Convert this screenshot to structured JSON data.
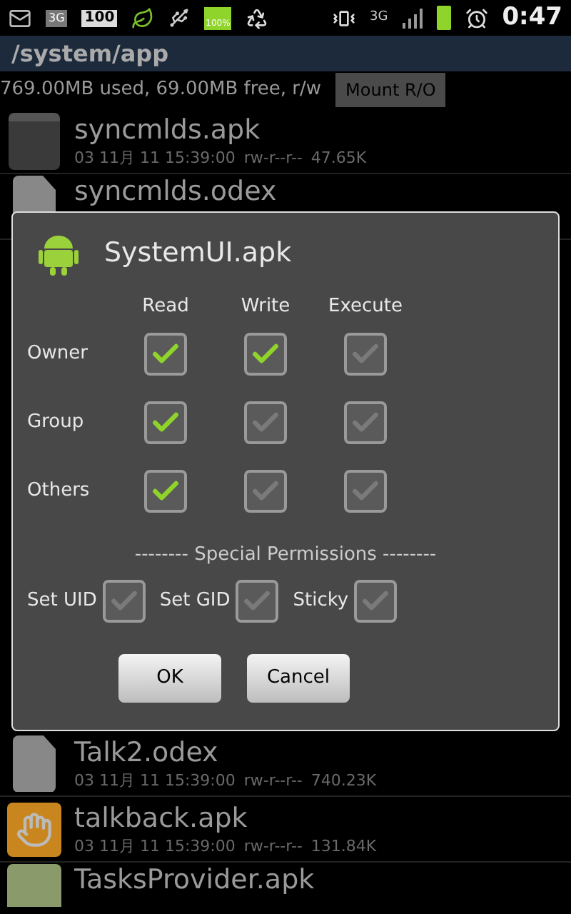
{
  "status_bar": {
    "left_badges": [
      "3G",
      "100"
    ],
    "network": "3G",
    "battery_label": "100%",
    "time": "0:47"
  },
  "path": "/system/app",
  "storage": {
    "info": "769.00MB used, 69.00MB free, r/w",
    "button": "Mount R/O"
  },
  "files_above": [
    {
      "name": "syncmlds.apk",
      "kind": "package",
      "date": "03 11月 11 15:39:00",
      "perms": "rw-r--r--",
      "size": "47.65K"
    },
    {
      "name": "syncmlds.odex",
      "kind": "odex"
    }
  ],
  "files_below": [
    {
      "name": "Talk2.odex",
      "kind": "odex",
      "date": "03 11月 11 15:39:00",
      "perms": "rw-r--r--",
      "size": "740.23K"
    },
    {
      "name": "talkback.apk",
      "kind": "hand",
      "date": "03 11月 11 15:39:00",
      "perms": "rw-r--r--",
      "size": "131.84K"
    },
    {
      "name": "TasksProvider.apk",
      "kind": "tasks"
    }
  ],
  "dialog": {
    "title": "SystemUI.apk",
    "columns": [
      "Read",
      "Write",
      "Execute"
    ],
    "rows": [
      {
        "label": "Owner",
        "checks": [
          true,
          true,
          false
        ]
      },
      {
        "label": "Group",
        "checks": [
          true,
          false,
          false
        ]
      },
      {
        "label": "Others",
        "checks": [
          true,
          false,
          false
        ]
      }
    ],
    "special_heading": "-------- Special Permissions --------",
    "special": [
      {
        "label": "Set UID",
        "checked": false
      },
      {
        "label": "Set GID",
        "checked": false
      },
      {
        "label": "Sticky",
        "checked": false
      }
    ],
    "buttons": [
      "OK",
      "Cancel"
    ]
  }
}
